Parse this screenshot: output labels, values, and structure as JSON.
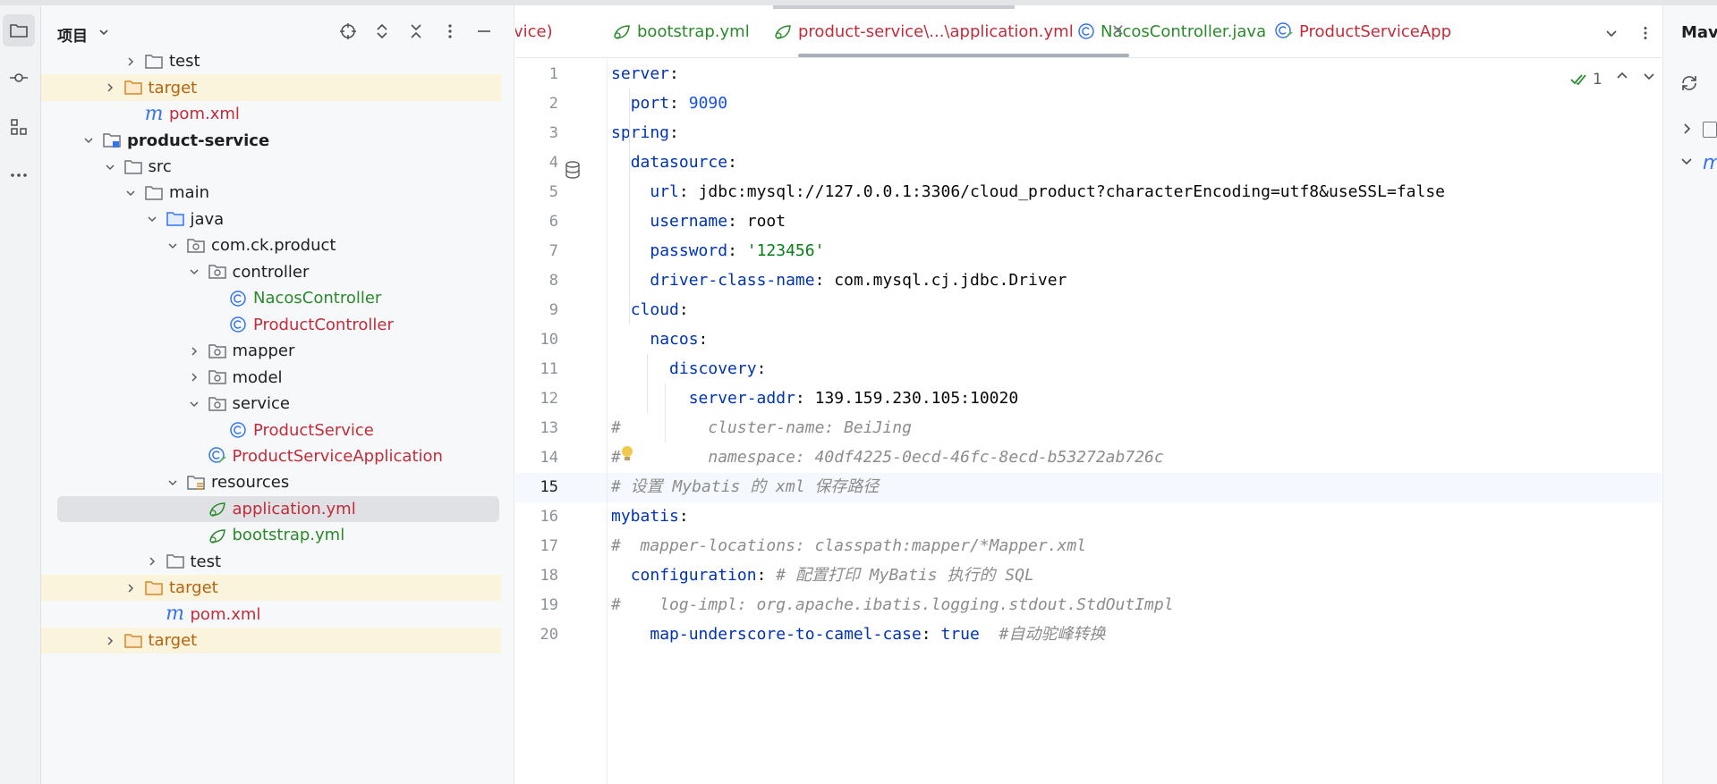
{
  "project_panel": {
    "title": "项目",
    "tree": [
      {
        "label": "test",
        "type": "folder",
        "color": "normal",
        "expanded": false
      },
      {
        "label": "target",
        "type": "folder-orange",
        "color": "orange",
        "expanded": false
      },
      {
        "label": "pom.xml",
        "type": "maven",
        "color": "red"
      },
      {
        "label": "product-service",
        "type": "module",
        "color": "normal",
        "bold": true,
        "expanded": true
      },
      {
        "label": "src",
        "type": "folder",
        "color": "normal",
        "expanded": true
      },
      {
        "label": "main",
        "type": "folder",
        "color": "normal",
        "expanded": true
      },
      {
        "label": "java",
        "type": "folder-blue",
        "color": "normal",
        "expanded": true
      },
      {
        "label": "com.ck.product",
        "type": "package",
        "color": "normal",
        "expanded": true
      },
      {
        "label": "controller",
        "type": "package",
        "color": "normal",
        "expanded": true
      },
      {
        "label": "NacosController",
        "type": "class",
        "color": "green"
      },
      {
        "label": "ProductController",
        "type": "class",
        "color": "red"
      },
      {
        "label": "mapper",
        "type": "package",
        "color": "normal",
        "expanded": false
      },
      {
        "label": "model",
        "type": "package",
        "color": "normal",
        "expanded": false
      },
      {
        "label": "service",
        "type": "package",
        "color": "normal",
        "expanded": true
      },
      {
        "label": "ProductService",
        "type": "class",
        "color": "red"
      },
      {
        "label": "ProductServiceApplication",
        "type": "springclass",
        "color": "red"
      },
      {
        "label": "resources",
        "type": "resources",
        "color": "normal",
        "expanded": true
      },
      {
        "label": "application.yml",
        "type": "yml",
        "color": "red",
        "selected": true
      },
      {
        "label": "bootstrap.yml",
        "type": "yml",
        "color": "green"
      },
      {
        "label": "test",
        "type": "folder",
        "color": "normal",
        "expanded": false
      },
      {
        "label": "target",
        "type": "folder-orange",
        "color": "orange",
        "expanded": false
      },
      {
        "label": "pom.xml",
        "type": "maven",
        "color": "red"
      },
      {
        "label": "target",
        "type": "folder-orange",
        "color": "orange",
        "expanded": false
      }
    ]
  },
  "tabs": [
    {
      "label": "vice)",
      "type": "plain",
      "color": "red"
    },
    {
      "label": "bootstrap.yml",
      "type": "yml",
      "color": "green"
    },
    {
      "label": "product-service\\...\\application.yml",
      "type": "yml",
      "color": "red",
      "active": true
    },
    {
      "label": "NacosController.java",
      "type": "class",
      "color": "green"
    },
    {
      "label": "ProductServiceApp",
      "type": "springclass",
      "color": "red"
    }
  ],
  "editor": {
    "inspection_count": "1",
    "current_line": 15,
    "lines": [
      "server:",
      "  port: 9090",
      "spring:",
      "  datasource:",
      "    url: jdbc:mysql://127.0.0.1:3306/cloud_product?characterEncoding=utf8&useSSL=false",
      "    username: root",
      "    password: '123456'",
      "    driver-class-name: com.mysql.cj.jdbc.Driver",
      "  cloud:",
      "    nacos:",
      "      discovery:",
      "        server-addr: 139.159.230.105:10020",
      "#         cluster-name: BeiJing",
      "#         namespace: 40df4225-0ecd-46fc-8ecd-b53272ab726c",
      "# 设置 Mybatis 的 xml 保存路径",
      "mybatis:",
      "#  mapper-locations: classpath:mapper/*Mapper.xml",
      "  configuration: # 配置打印 MyBatis 执行的 SQL",
      "#    log-impl: org.apache.ibatis.logging.stdout.StdOutImpl",
      "    map-underscore-to-camel-case: true  #自动驼峰转换"
    ]
  },
  "right_panel": {
    "title": "Maven"
  },
  "colors": {
    "accent": "#3574f0",
    "selection": "#dfe1e5",
    "excluded": "#fbf4dd"
  }
}
